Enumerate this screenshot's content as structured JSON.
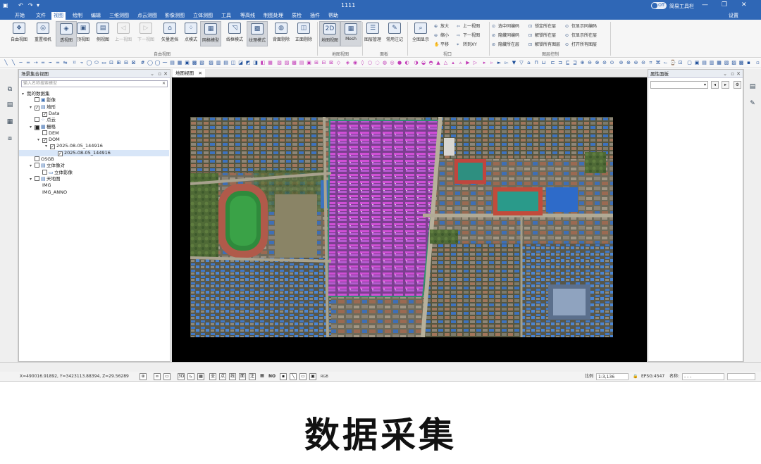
{
  "app": {
    "title": "1111",
    "tool_toggle": "Off",
    "tool_label": "简易工具栏",
    "settings": "设置"
  },
  "menu": [
    "开始",
    "文件",
    "视图",
    "绘制",
    "编辑",
    "三维测图",
    "点云测图",
    "影像测图",
    "立体测图",
    "工具",
    "等高线",
    "制图处理",
    "质检",
    "插件",
    "帮助"
  ],
  "menu_active": "视图",
  "ribbon": {
    "free_view": [
      {
        "label": "自由视图",
        "icon": "❖",
        "state": "normal"
      },
      {
        "label": "重置相机",
        "icon": "◎",
        "state": "normal"
      },
      {
        "label": "透视图",
        "icon": "◈",
        "state": "selected"
      },
      {
        "label": "顶视图",
        "icon": "▣",
        "state": "normal"
      },
      {
        "label": "侧视图",
        "icon": "▤",
        "state": "normal"
      },
      {
        "label": "上一视图",
        "icon": "◁",
        "state": "disabled"
      },
      {
        "label": "下一视图",
        "icon": "▷",
        "state": "disabled"
      },
      {
        "label": "矢量遮挡",
        "icon": "⌂",
        "state": "normal"
      },
      {
        "label": "点模式",
        "icon": "⁘",
        "state": "normal"
      },
      {
        "label": "网格模型",
        "icon": "▦",
        "state": "selected"
      },
      {
        "label": "线框模式",
        "icon": "◹",
        "state": "normal"
      },
      {
        "label": "纹理模式",
        "icon": "▩",
        "state": "selected"
      },
      {
        "label": "背面剔除",
        "icon": "◍",
        "state": "normal"
      },
      {
        "label": "正面剔除",
        "icon": "◫",
        "state": "normal"
      }
    ],
    "free_view_group": "自由视图",
    "map_view": [
      {
        "label": "地图视图",
        "icon": "2D",
        "state": "selected"
      },
      {
        "label": "Mesh",
        "icon": "▦",
        "state": "selected"
      }
    ],
    "map_view_group": "地图视图",
    "panel": [
      {
        "label": "图层管理",
        "icon": "☰",
        "state": "normal"
      },
      {
        "label": "常用注记",
        "icon": "✎",
        "state": "normal"
      }
    ],
    "panel_group": "面板",
    "window_full": {
      "label": "全图显示",
      "icon": "⌕"
    },
    "window_small": [
      {
        "label": "放大",
        "icon": "⊕"
      },
      {
        "label": "缩小",
        "icon": "⊖"
      },
      {
        "label": "平移",
        "icon": "✋"
      },
      {
        "label": "上一视图",
        "icon": "⇦"
      },
      {
        "label": "下一视图",
        "icon": "⇨"
      },
      {
        "label": "转到XY",
        "icon": "⌖"
      }
    ],
    "window_group": "视口",
    "layer_small": [
      {
        "label": "选中同编码",
        "icon": "⊙"
      },
      {
        "label": "隐藏同编码",
        "icon": "⊘"
      },
      {
        "label": "隐藏所在层",
        "icon": "⊘"
      },
      {
        "label": "锁定所在层",
        "icon": "⊡"
      },
      {
        "label": "解锁所在层",
        "icon": "⊡"
      },
      {
        "label": "解锁所有图层",
        "icon": "⊡"
      },
      {
        "label": "仅显示同编码",
        "icon": "⊙"
      },
      {
        "label": "仅显示所在层",
        "icon": "⊙"
      },
      {
        "label": "打开所有图层",
        "icon": "⊙"
      }
    ],
    "layer_group": "图层控制"
  },
  "scene_panel": {
    "title": "场景集合视图",
    "search_placeholder": "输入名称搜索模型",
    "tree": [
      {
        "label": "我的数据集",
        "depth": 0,
        "arrow": "▾",
        "checkbox": false,
        "checked": "",
        "icon": ""
      },
      {
        "label": "影像",
        "depth": 1,
        "arrow": "",
        "checkbox": true,
        "checked": "",
        "icon": "▣"
      },
      {
        "label": "地形",
        "depth": 1,
        "arrow": "▾",
        "checkbox": true,
        "checked": "✓",
        "icon": "▤"
      },
      {
        "label": "Data",
        "depth": 2,
        "arrow": "",
        "checkbox": true,
        "checked": "✓",
        "icon": ""
      },
      {
        "label": "点云",
        "depth": 1,
        "arrow": "",
        "checkbox": true,
        "checked": "",
        "icon": "⁘"
      },
      {
        "label": "栅格",
        "depth": 1,
        "arrow": "▾",
        "checkbox": true,
        "checked": "■",
        "icon": "▦"
      },
      {
        "label": "DEM",
        "depth": 2,
        "arrow": "",
        "checkbox": true,
        "checked": "",
        "icon": ""
      },
      {
        "label": "DOM",
        "depth": 2,
        "arrow": "▾",
        "checkbox": true,
        "checked": "✓",
        "icon": ""
      },
      {
        "label": "2025-08-05_144916",
        "depth": 3,
        "arrow": "▾",
        "checkbox": true,
        "checked": "✓",
        "icon": ""
      },
      {
        "label": "2025-08-05_144916",
        "depth": 4,
        "arrow": "",
        "checkbox": true,
        "checked": "✓",
        "icon": "",
        "selected": true
      },
      {
        "label": "OSGB",
        "depth": 1,
        "arrow": "",
        "checkbox": true,
        "checked": "",
        "icon": ""
      },
      {
        "label": "立体像对",
        "depth": 1,
        "arrow": "▾",
        "checkbox": true,
        "checked": "",
        "icon": "▤"
      },
      {
        "label": "立体影像",
        "depth": 2,
        "arrow": "",
        "checkbox": true,
        "checked": "",
        "icon": "▭"
      },
      {
        "label": "天地图",
        "depth": 1,
        "arrow": "▾",
        "checkbox": true,
        "checked": "",
        "icon": "▤"
      },
      {
        "label": "IMG",
        "depth": 2,
        "arrow": "",
        "checkbox": false,
        "checked": "",
        "icon": ""
      },
      {
        "label": "IMG_ANNO",
        "depth": 2,
        "arrow": "",
        "checkbox": false,
        "checked": "",
        "icon": ""
      }
    ]
  },
  "map_tab": "地图视图",
  "prop_panel": {
    "title": "属性面板"
  },
  "status": {
    "coords": "X=490016.91892, Y=3423113.88394, Z=29.56289",
    "modes": [
      "全",
      "点",
      "线",
      "面",
      "注"
    ],
    "no": "NO",
    "scale_label": "比例",
    "scale_value": "1:3,136",
    "epsg": "EPSG:4547",
    "name_label": "名称:",
    "name_value": "- - -"
  },
  "caption": "数据采集"
}
